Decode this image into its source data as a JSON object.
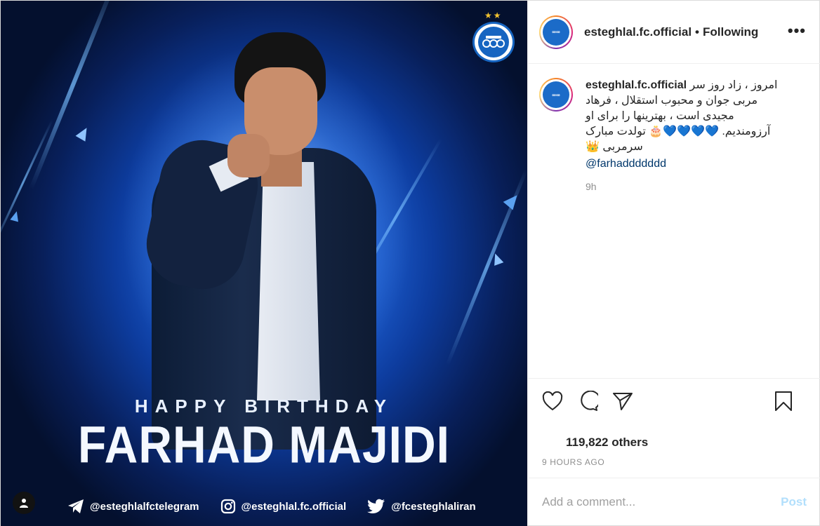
{
  "media": {
    "greeting": "HAPPY BIRTHDAY",
    "player_name": "FARHAD MAJIDI",
    "socials": [
      {
        "icon": "telegram-icon",
        "handle": "@esteghlalfctelegram"
      },
      {
        "icon": "instagram-icon",
        "handle": "@esteghlal.fc.official"
      },
      {
        "icon": "twitter-icon",
        "handle": "@fcesteghlaliran"
      }
    ]
  },
  "header": {
    "username": "esteghlal.fc.official",
    "separator": "•",
    "follow_status": "Following",
    "more": "•••"
  },
  "caption": {
    "username": "esteghlal.fc.official",
    "text": "امروز ، زاد روز سر مربی جوان و محبوب استقلال ، فرهاد مجیدی است ، بهترینها را برای او آرزومندیم. 💙💙💙💙🎂 تولدت مبارک سرمربی 👑",
    "mention": "@farhaddddddd",
    "time": "9h"
  },
  "engagement": {
    "likes": "119,822 others",
    "posted_ago": "9 HOURS AGO"
  },
  "comment": {
    "placeholder": "Add a comment...",
    "post_label": "Post"
  },
  "colors": {
    "accent_blue": "#1765c1",
    "link": "#00376b",
    "post_disabled": "#b2dffc"
  }
}
